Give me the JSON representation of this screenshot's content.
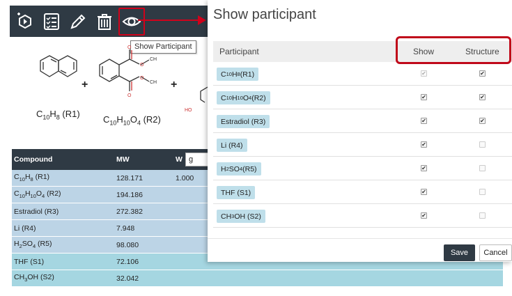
{
  "toolbar": {
    "tooltip": "Show Participant",
    "icons": [
      "add-participant-icon",
      "checklist-icon",
      "pencil-icon",
      "trash-icon",
      "eye-icon"
    ]
  },
  "scheme": {
    "r1": {
      "base": "C",
      "s1": "10",
      "mid": "H",
      "s2": "8",
      "tail": " (R1)"
    },
    "r2": {
      "base": "C",
      "s1": "10",
      "mid": "H",
      "s2": "10",
      "mid2": "O",
      "s3": "4",
      "tail": " (R2)"
    },
    "plus": "+",
    "ch3": "CH",
    "ch3sub": "3",
    "o": "O",
    "ho": "HO"
  },
  "table": {
    "headers": {
      "compound": "Compound",
      "mw": "MW",
      "w": "W",
      "unit": "g"
    },
    "rows": [
      {
        "name": {
          "a": "C",
          "b": "10",
          "c": "H",
          "d": "8",
          "e": " (R1)"
        },
        "mw": "128.171",
        "w": "1.000",
        "bg": "#bcd4e6"
      },
      {
        "name": {
          "a": "C",
          "b": "10",
          "c": "H",
          "d": "10",
          "e": "O",
          "f": "4",
          "g": " (R2)"
        },
        "mw": "194.186",
        "w": "",
        "bg": "#bcd4e6"
      },
      {
        "name": "Estradiol (R3)",
        "mw": "272.382",
        "w": "",
        "bg": "#bcd4e6"
      },
      {
        "name": "Li (R4)",
        "mw": "7.948",
        "w": "",
        "bg": "#bcd4e6"
      },
      {
        "name": {
          "a": "H",
          "b": "2",
          "c": "SO",
          "d": "4",
          "e": " (R5)"
        },
        "mw": "98.080",
        "w": "",
        "bg": "#bcd4e6"
      },
      {
        "name": "THF (S1)",
        "mw": "72.106",
        "w": "",
        "bg": "#a5d6e1"
      },
      {
        "name": {
          "a": "CH",
          "b": "3",
          "c": "OH (S2)"
        },
        "mw": "32.042",
        "w": "",
        "bg": "#a5d6e1"
      }
    ]
  },
  "modal": {
    "title": "Show participant",
    "headers": {
      "participant": "Participant",
      "show": "Show",
      "structure": "Structure"
    },
    "rows": [
      {
        "label": {
          "a": "C",
          "b": "10",
          "c": "H",
          "d": "8",
          "e": " (R1)"
        },
        "show": true,
        "show_disabled": true,
        "structure": true
      },
      {
        "label": {
          "a": "C",
          "b": "10",
          "c": "H",
          "d": "10",
          "e": "O",
          "f": "4",
          "g": " (R2)"
        },
        "show": true,
        "show_disabled": false,
        "structure": true
      },
      {
        "label": "Estradiol (R3)",
        "show": true,
        "show_disabled": false,
        "structure": true
      },
      {
        "label": "Li (R4)",
        "show": true,
        "show_disabled": false,
        "structure": false
      },
      {
        "label": {
          "a": "H",
          "b": "2",
          "c": "SO",
          "d": "4",
          "e": " (R5)"
        },
        "show": true,
        "show_disabled": false,
        "structure": false
      },
      {
        "label": "THF (S1)",
        "show": true,
        "show_disabled": false,
        "structure": false
      },
      {
        "label": {
          "a": "CH",
          "b": "3",
          "c": "OH (S2)"
        },
        "show": true,
        "show_disabled": false,
        "structure": false
      }
    ],
    "save_label": "Save",
    "cancel_label": "Cancel"
  },
  "colors": {
    "accent": "#d0021b",
    "toolbar": "#2f3a44",
    "chip": "#bfdfea"
  }
}
